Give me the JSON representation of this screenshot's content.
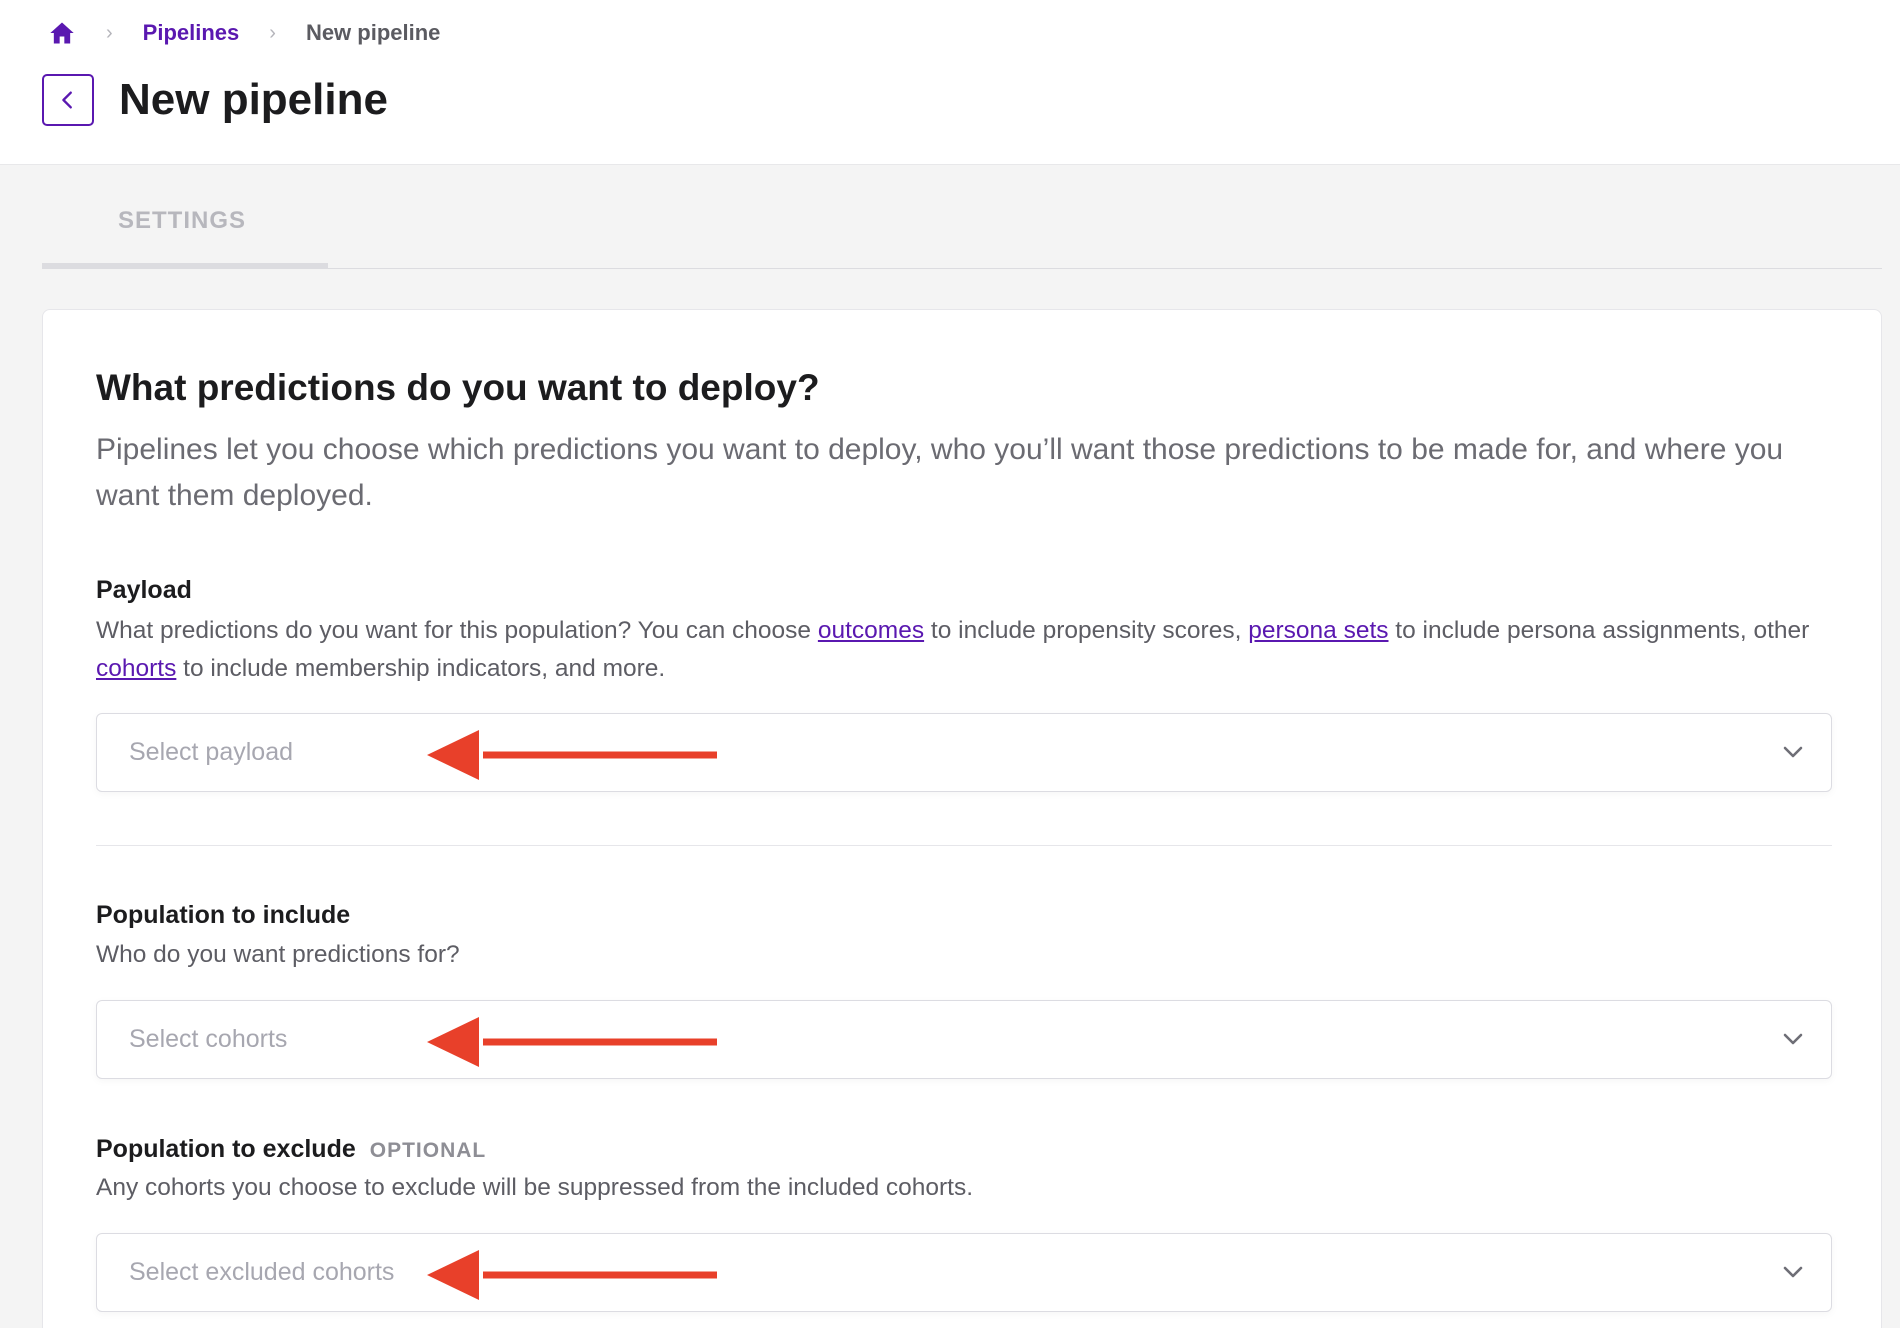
{
  "breadcrumb": {
    "home_icon": "home-icon",
    "items": [
      "Pipelines",
      "New pipeline"
    ]
  },
  "header": {
    "back_icon": "chevron-left-icon",
    "title": "New pipeline"
  },
  "tabs": [
    {
      "label": "SETTINGS"
    }
  ],
  "card": {
    "heading": "What predictions do you want to deploy?",
    "description": "Pipelines let you choose which predictions you want to deploy, who you’ll want those predictions to be made for, and where you want them deployed.",
    "payload": {
      "label": "Payload",
      "help_parts": [
        "What predictions do you want for this population? You can choose ",
        "outcomes",
        " to include propensity scores, ",
        "persona sets",
        " to include persona assignments, other ",
        "cohorts",
        " to include membership indicators, and more."
      ],
      "placeholder": "Select payload"
    },
    "include": {
      "label": "Population to include",
      "help": "Who do you want predictions for?",
      "placeholder": "Select cohorts"
    },
    "exclude": {
      "label": "Population to exclude",
      "optional": "OPTIONAL",
      "help": "Any cohorts you choose to exclude will be suppressed from the included cohorts.",
      "placeholder": "Select excluded cohorts"
    }
  },
  "colors": {
    "accent": "#5a18b0",
    "annotation_arrow": "#e8402a"
  }
}
